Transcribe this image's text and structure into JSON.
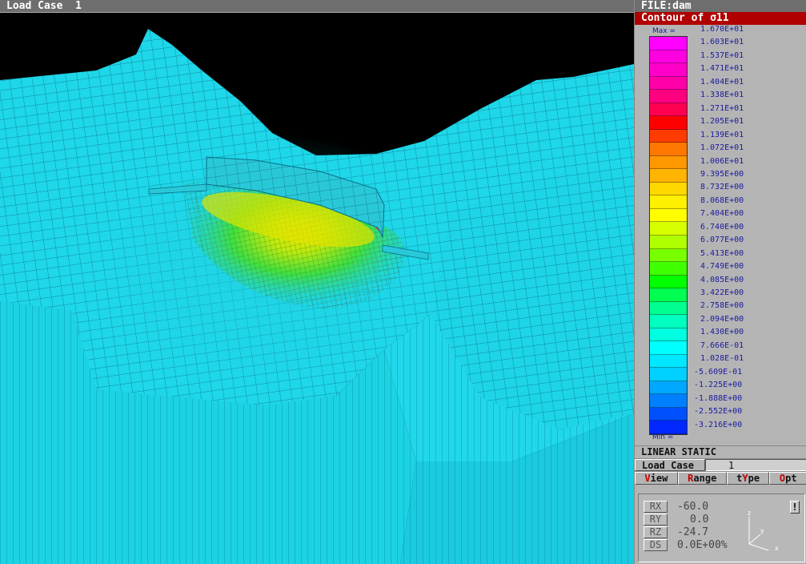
{
  "top_bar": {
    "title": "Load Case  1"
  },
  "panel": {
    "file_title": "FILE:dam",
    "contour_title": "Contour of σ11",
    "legend": {
      "max_label": "Max =",
      "min_label": "Min =",
      "values": [
        "1.670E+01",
        "1.603E+01",
        "1.537E+01",
        "1.471E+01",
        "1.404E+01",
        "1.338E+01",
        "1.271E+01",
        "1.205E+01",
        "1.139E+01",
        "1.072E+01",
        "1.006E+01",
        "9.395E+00",
        "8.732E+00",
        "8.068E+00",
        "7.404E+00",
        "6.740E+00",
        "6.077E+00",
        "5.413E+00",
        "4.749E+00",
        "4.085E+00",
        "3.422E+00",
        "2.758E+00",
        "2.094E+00",
        "1.430E+00",
        "7.666E-01",
        "1.028E-01",
        "-5.609E-01",
        "-1.225E+00",
        "-1.888E+00",
        "-2.552E+00",
        "-3.216E+00"
      ],
      "colors": [
        "#ff00ff",
        "#ff00e0",
        "#ff00c8",
        "#ff00a8",
        "#ff0080",
        "#ff0050",
        "#ff0000",
        "#ff3c00",
        "#ff7800",
        "#ff9800",
        "#ffb400",
        "#ffd800",
        "#fff000",
        "#ffff00",
        "#d8ff00",
        "#b0ff00",
        "#78ff00",
        "#40ff00",
        "#00ff00",
        "#00ff50",
        "#00ff90",
        "#00ffc0",
        "#00ffe0",
        "#00ffff",
        "#00e8ff",
        "#00d0ff",
        "#00a8ff",
        "#0080ff",
        "#0050ff",
        "#0028ff"
      ]
    },
    "analysis_type": "LINEAR STATIC",
    "load_case": {
      "label": "Load Case",
      "value": "1"
    },
    "menu": [
      {
        "hot": "V",
        "rest": "iew"
      },
      {
        "hot": "R",
        "rest": "ange"
      },
      {
        "pre": "t",
        "hot": "Y",
        "rest": "pe"
      },
      {
        "hot": "O",
        "rest": "pt"
      }
    ],
    "view_info": {
      "rx_label": "RX",
      "rx_value": "-60.0",
      "ry_label": "RY",
      "ry_value": "0.0",
      "rz_label": "RZ",
      "rz_value": "-24.7",
      "ds_label": "DS",
      "ds_value": "0.0E+00%",
      "excl_label": "!",
      "axes": {
        "x": "x",
        "y": "y",
        "z": "z"
      }
    }
  },
  "colors": {
    "model_base": "#1ed7e8",
    "mesh_line": "#0a6f88",
    "title_red": "#b00000"
  }
}
